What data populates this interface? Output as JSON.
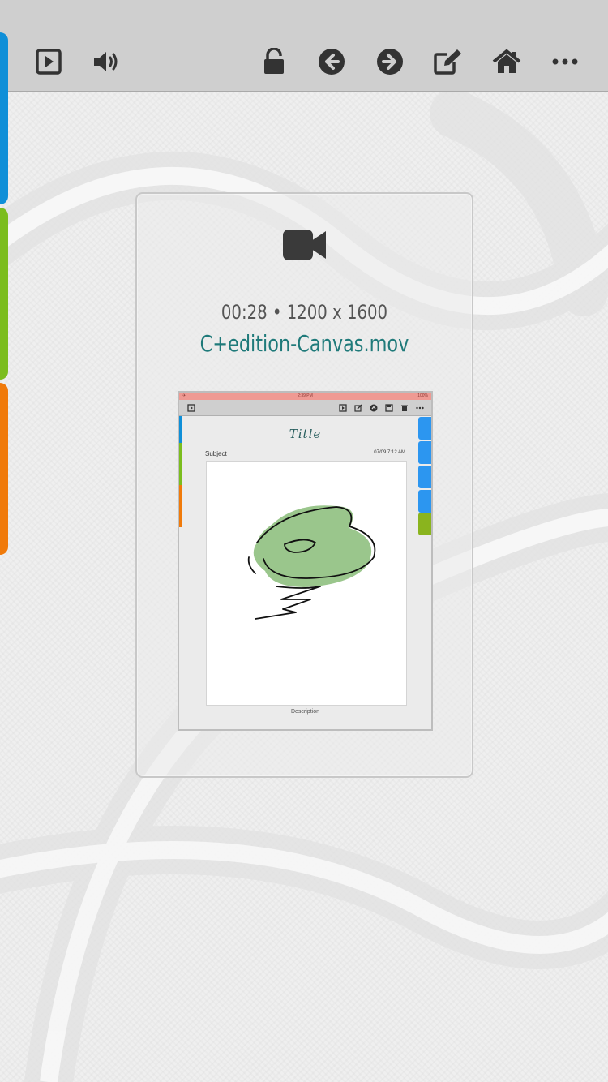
{
  "toolbar": {
    "left": [
      {
        "name": "play-icon"
      },
      {
        "name": "speaker-icon"
      }
    ],
    "right": [
      {
        "name": "unlock-icon"
      },
      {
        "name": "arrow-left-icon"
      },
      {
        "name": "arrow-right-icon"
      },
      {
        "name": "edit-icon"
      },
      {
        "name": "home-icon"
      },
      {
        "name": "more-icon"
      }
    ]
  },
  "side_tabs": {
    "colors": [
      "#0f8fd8",
      "#7bbd1e",
      "#f07a0a"
    ]
  },
  "media": {
    "icon": "video-camera-icon",
    "meta": "00:28 • 1200 x 1600",
    "filename": "C+edition-Canvas.mov"
  },
  "thumbnail": {
    "status_time": "2:39 PM",
    "status_battery": "100%",
    "title": "Title",
    "subject": "Subject",
    "date": "07/09  7:12 AM",
    "description": "Description"
  }
}
